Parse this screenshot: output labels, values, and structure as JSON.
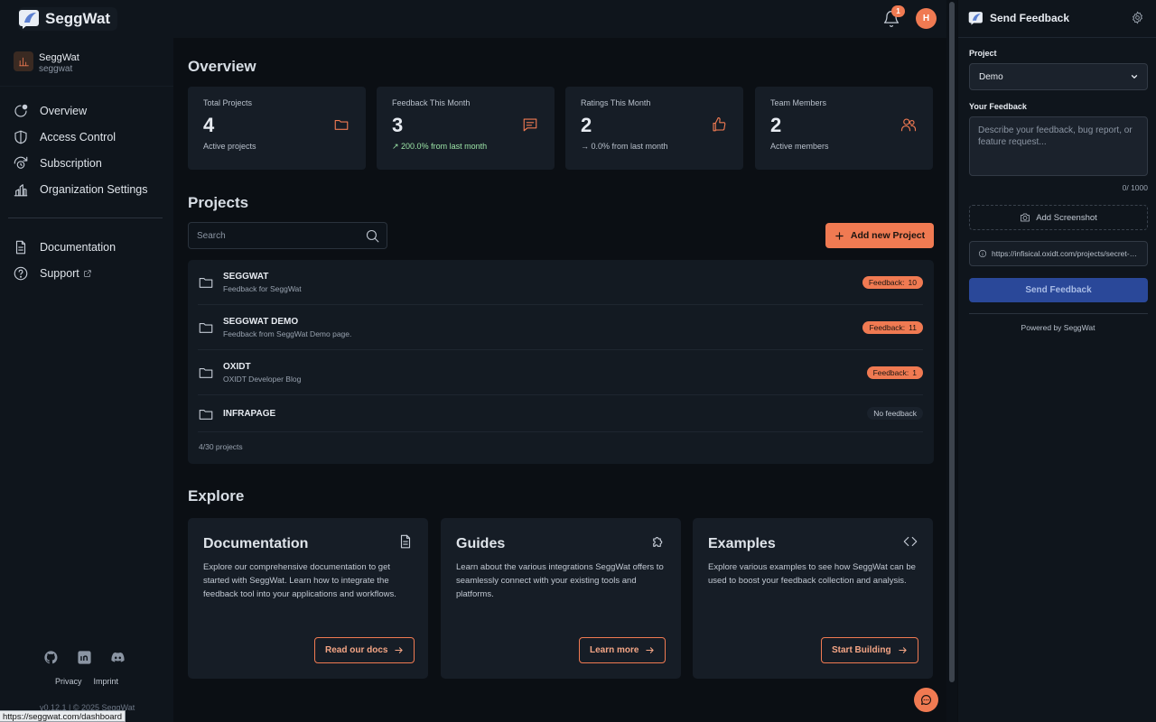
{
  "app": {
    "name": "SeggWat"
  },
  "header": {
    "notification_count": "1",
    "user_initial": "H"
  },
  "sidebar": {
    "org": {
      "name": "SeggWat",
      "slug": "seggwat"
    },
    "items": [
      {
        "label": "Overview",
        "icon": "overview-icon"
      },
      {
        "label": "Access Control",
        "icon": "shield-icon"
      },
      {
        "label": "Subscription",
        "icon": "subscription-icon"
      },
      {
        "label": "Organization Settings",
        "icon": "building-icon"
      }
    ],
    "secondary": [
      {
        "label": "Documentation",
        "icon": "document-icon"
      },
      {
        "label": "Support",
        "icon": "help-icon"
      }
    ],
    "footer": {
      "privacy": "Privacy",
      "imprint": "Imprint",
      "version": "v0.12.1 | © 2025 SeggWat"
    }
  },
  "status_bar_url": "https://seggwat.com/dashboard",
  "overview": {
    "title": "Overview",
    "stats": [
      {
        "label": "Total Projects",
        "value": "4",
        "sub": "Active projects",
        "icon": "folder-icon"
      },
      {
        "label": "Feedback This Month",
        "value": "3",
        "sub": "↗ 200.0% from last month",
        "icon": "message-icon"
      },
      {
        "label": "Ratings This Month",
        "value": "2",
        "sub": "→ 0.0% from last month",
        "icon": "thumbs-up-icon"
      },
      {
        "label": "Team Members",
        "value": "2",
        "sub": "Active members",
        "icon": "users-icon"
      }
    ]
  },
  "projects": {
    "title": "Projects",
    "search_placeholder": "Search",
    "add_label": "Add new Project",
    "feedback_prefix": "Feedback:",
    "list": [
      {
        "name": "SEGGWAT",
        "desc": "Feedback for SeggWat",
        "feedback": "10"
      },
      {
        "name": "SEGGWAT DEMO",
        "desc": "Feedback from SeggWat Demo page.",
        "feedback": "11"
      },
      {
        "name": "OXIDT",
        "desc": "OXIDT Developer Blog",
        "feedback": "1"
      },
      {
        "name": "INFRAPAGE",
        "desc": "",
        "feedback": "",
        "no_feedback": "No feedback"
      }
    ],
    "count": "4/30 projects"
  },
  "explore": {
    "title": "Explore",
    "cards": [
      {
        "title": "Documentation",
        "desc": "Explore our comprehensive documentation to get started with SeggWat. Learn how to integrate the feedback tool into your applications and workflows.",
        "button": "Read our docs",
        "icon": "document-icon"
      },
      {
        "title": "Guides",
        "desc": "Learn about the various integrations SeggWat offers to seamlessly connect with your existing tools and platforms.",
        "button": "Learn more",
        "icon": "puzzle-icon"
      },
      {
        "title": "Examples",
        "desc": "Explore various examples to see how SeggWat can be used to boost your feedback collection and analysis.",
        "button": "Start Building",
        "icon": "code-icon"
      }
    ]
  },
  "feedback_panel": {
    "title": "Send Feedback",
    "project_label": "Project",
    "project_value": "Demo",
    "feedback_label": "Your Feedback",
    "feedback_placeholder": "Describe your feedback, bug report, or feature request...",
    "char_count": "0/ 1000",
    "screenshot_label": "Add Screenshot",
    "url": "https://infisical.oxidt.com/projects/secret-management/...",
    "send_label": "Send Feedback",
    "powered_by": "Powered by SeggWat"
  },
  "colors": {
    "accent": "#f07a52",
    "background": "#0b0f14",
    "surface": "#161d26",
    "send_button": "#2a4899"
  }
}
